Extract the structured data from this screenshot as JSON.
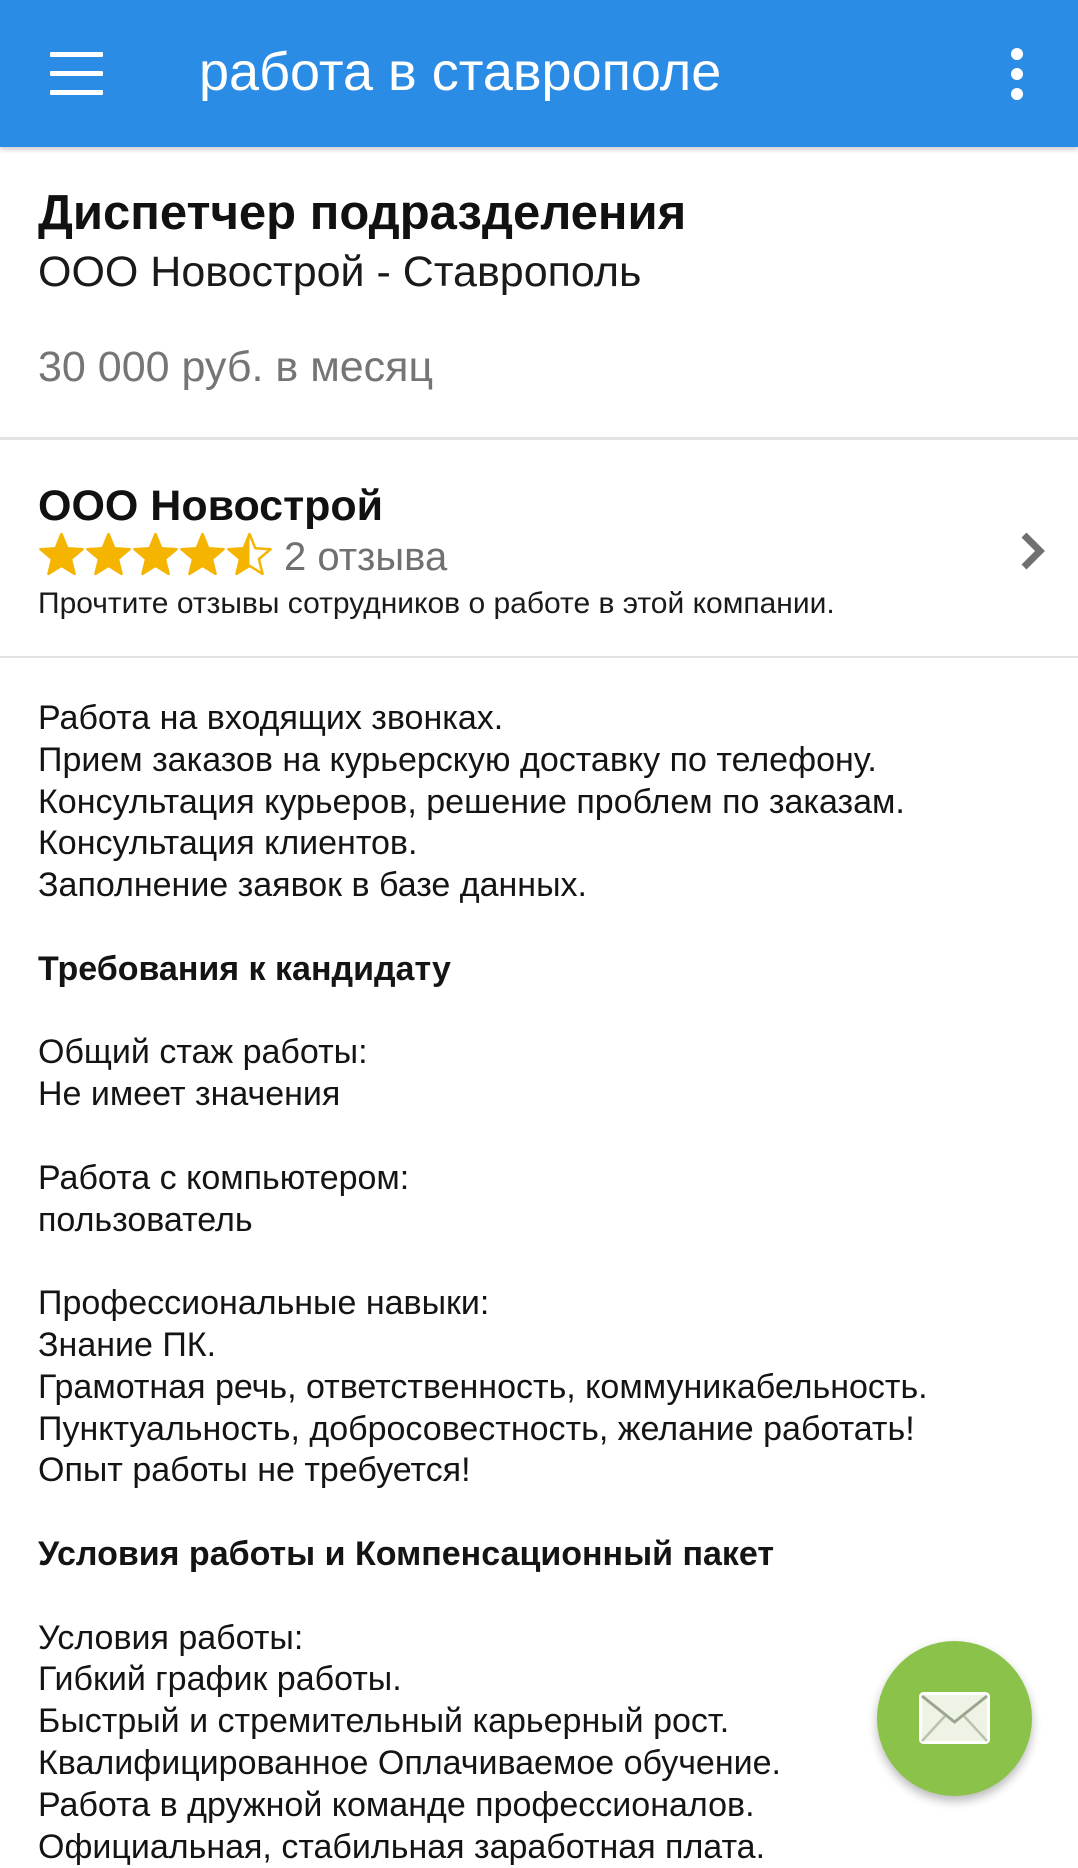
{
  "appbar": {
    "title": "работа в ставрополе",
    "menu_icon": "hamburger-menu-icon",
    "overflow_icon": "more-vert-icon"
  },
  "job": {
    "title": "Диспетчер подразделения",
    "company_location": "ООО Новострой - Ставрополь",
    "salary": "30 000 руб. в месяц"
  },
  "company": {
    "name": "ООО Новострой",
    "rating": 4.5,
    "rating_max": 5,
    "reviews_label": "2 отзыва",
    "note": "Прочтите отзывы сотрудников о работе в этой компании.",
    "chevron_icon": "chevron-right-icon"
  },
  "description": {
    "lines": [
      {
        "text": "Работа на входящих звонках.",
        "type": "text"
      },
      {
        "text": "Прием заказов на курьерскую доставку по телефону.",
        "type": "text"
      },
      {
        "text": "Консультация курьеров, решение проблем по заказам.",
        "type": "text"
      },
      {
        "text": "Консультация клиентов.",
        "type": "text"
      },
      {
        "text": "Заполнение заявок в базе данных.",
        "type": "text"
      },
      {
        "text": "",
        "type": "gap"
      },
      {
        "text": "Требования к кандидату",
        "type": "heading"
      },
      {
        "text": "",
        "type": "gap"
      },
      {
        "text": "Общий стаж работы:",
        "type": "text"
      },
      {
        "text": "Не имеет значения",
        "type": "text"
      },
      {
        "text": "",
        "type": "gap"
      },
      {
        "text": "Работа с компьютером:",
        "type": "text"
      },
      {
        "text": "пользователь",
        "type": "text"
      },
      {
        "text": "",
        "type": "gap"
      },
      {
        "text": "Профессиональные навыки:",
        "type": "text"
      },
      {
        "text": "Знание ПК.",
        "type": "text"
      },
      {
        "text": "Грамотная речь, ответственность, коммуникабельность.",
        "type": "text"
      },
      {
        "text": "Пунктуальность, добросовестность, желание работать!",
        "type": "text"
      },
      {
        "text": "Опыт работы не требуется!",
        "type": "text"
      },
      {
        "text": "",
        "type": "gap"
      },
      {
        "text": "Условия работы и Компенсационный пакет",
        "type": "heading"
      },
      {
        "text": "",
        "type": "gap"
      },
      {
        "text": "Условия работы:",
        "type": "text"
      },
      {
        "text": "Гибкий график работы.",
        "type": "text"
      },
      {
        "text": "Быстрый и стремительный карьерный рост.",
        "type": "text"
      },
      {
        "text": "Квалифицированное Оплачиваемое обучение.",
        "type": "text"
      },
      {
        "text": "Работа в дружной команде профессионалов.",
        "type": "text"
      },
      {
        "text": "Официальная, стабильная заработная плата.",
        "type": "text"
      }
    ]
  },
  "fab": {
    "icon": "envelope-icon",
    "color": "#8bc34a"
  },
  "colors": {
    "appbar": "#2b8ce6",
    "star": "#f4b400",
    "salary_text": "#757575"
  }
}
